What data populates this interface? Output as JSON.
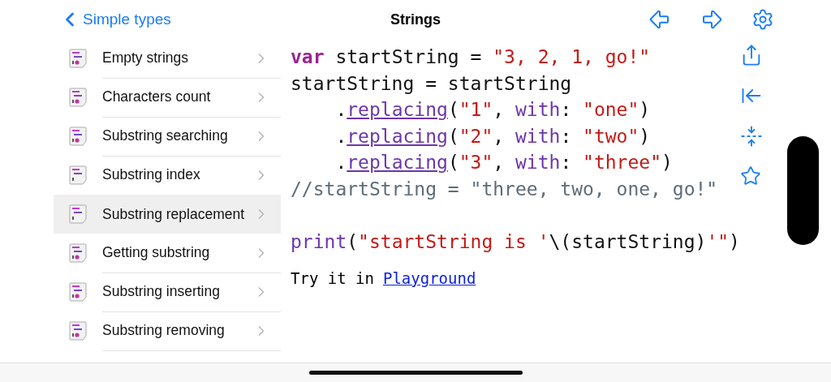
{
  "nav": {
    "back": "Simple types",
    "title": "Strings"
  },
  "sidebar": {
    "items": [
      {
        "label": "Empty strings",
        "selected": false,
        "dot": true
      },
      {
        "label": "Characters count",
        "selected": false,
        "dot": true
      },
      {
        "label": "Substring searching",
        "selected": false,
        "dot": true
      },
      {
        "label": "Substring index",
        "selected": false,
        "dot": false
      },
      {
        "label": "Substring replacement",
        "selected": true,
        "dot": false
      },
      {
        "label": "Getting substring",
        "selected": false,
        "dot": true
      },
      {
        "label": "Substring inserting",
        "selected": false,
        "dot": true
      },
      {
        "label": "Substring removing",
        "selected": false,
        "dot": true
      }
    ]
  },
  "code": {
    "lines": [
      {
        "tokens": [
          {
            "kind": "keyword",
            "text": "var"
          },
          {
            "kind": "plain",
            "text": " startString = "
          },
          {
            "kind": "string",
            "text": "\"3, 2, 1, go!\""
          }
        ]
      },
      {
        "tokens": [
          {
            "kind": "plain",
            "text": "startString = startString"
          }
        ]
      },
      {
        "tokens": [
          {
            "kind": "plain",
            "text": "    ."
          },
          {
            "kind": "method",
            "text": "replacing"
          },
          {
            "kind": "plain",
            "text": "("
          },
          {
            "kind": "string",
            "text": "\"1\""
          },
          {
            "kind": "plain",
            "text": ", "
          },
          {
            "kind": "param",
            "text": "with"
          },
          {
            "kind": "plain",
            "text": ": "
          },
          {
            "kind": "string",
            "text": "\"one\""
          },
          {
            "kind": "plain",
            "text": ")"
          }
        ]
      },
      {
        "tokens": [
          {
            "kind": "plain",
            "text": "    ."
          },
          {
            "kind": "method",
            "text": "replacing"
          },
          {
            "kind": "plain",
            "text": "("
          },
          {
            "kind": "string",
            "text": "\"2\""
          },
          {
            "kind": "plain",
            "text": ", "
          },
          {
            "kind": "param",
            "text": "with"
          },
          {
            "kind": "plain",
            "text": ": "
          },
          {
            "kind": "string",
            "text": "\"two\""
          },
          {
            "kind": "plain",
            "text": ")"
          }
        ]
      },
      {
        "tokens": [
          {
            "kind": "plain",
            "text": "    ."
          },
          {
            "kind": "method",
            "text": "replacing"
          },
          {
            "kind": "plain",
            "text": "("
          },
          {
            "kind": "string",
            "text": "\"3\""
          },
          {
            "kind": "plain",
            "text": ", "
          },
          {
            "kind": "param",
            "text": "with"
          },
          {
            "kind": "plain",
            "text": ": "
          },
          {
            "kind": "string",
            "text": "\"three\""
          },
          {
            "kind": "plain",
            "text": ")"
          }
        ]
      },
      {
        "tokens": [
          {
            "kind": "comment",
            "text": "//startString = \"three, two, one, go!\""
          }
        ]
      },
      {
        "gap_before": true,
        "tokens": [
          {
            "kind": "param",
            "text": "print"
          },
          {
            "kind": "plain",
            "text": "("
          },
          {
            "kind": "string",
            "text": "\"startString is '"
          },
          {
            "kind": "plain",
            "text": "\\(startString)"
          },
          {
            "kind": "string",
            "text": "'\""
          },
          {
            "kind": "plain",
            "text": ")"
          }
        ]
      }
    ]
  },
  "try_it": {
    "text": "Try it in",
    "link": "Playground"
  }
}
